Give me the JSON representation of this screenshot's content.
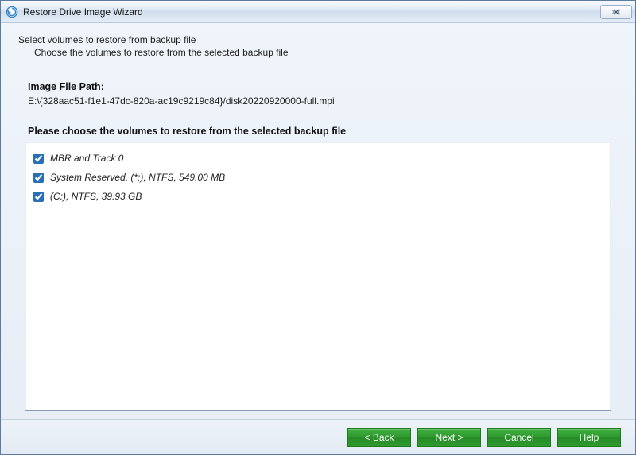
{
  "window": {
    "title": "Restore Drive Image Wizard"
  },
  "intro": {
    "heading": "Select volumes to restore from backup file",
    "sub": "Choose the volumes to restore from the selected backup file"
  },
  "image_file": {
    "label": "Image File Path:",
    "path": "E:\\{328aac51-f1e1-47dc-820a-ac19c9219c84}/disk20220920000-full.mpi"
  },
  "choose_label": "Please choose the volumes to restore from the selected backup file",
  "volumes": [
    {
      "label": "MBR and Track 0",
      "checked": true
    },
    {
      "label": "System Reserved, (*:), NTFS, 549.00 MB",
      "checked": true
    },
    {
      "label": "(C:), NTFS, 39.93 GB",
      "checked": true
    }
  ],
  "buttons": {
    "back": "< Back",
    "next": "Next >",
    "cancel": "Cancel",
    "help": "Help"
  }
}
